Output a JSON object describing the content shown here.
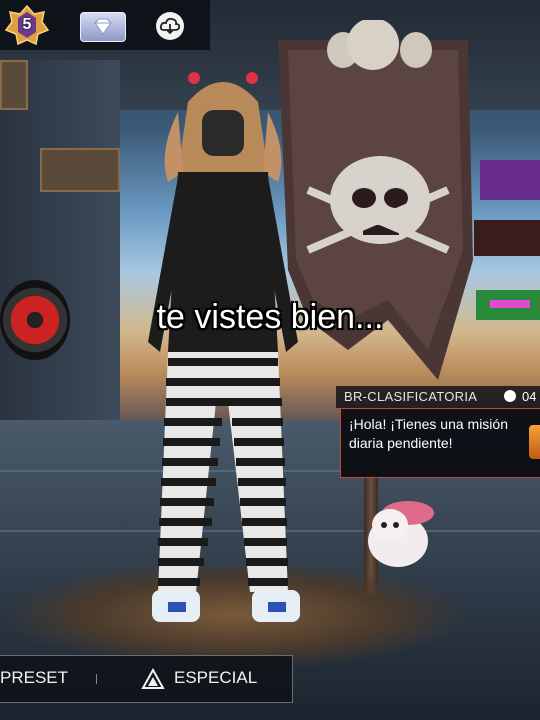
{
  "hud": {
    "rank_level": "5",
    "icons": [
      "rank-badge-icon",
      "diamond-icon",
      "cloud-download-icon"
    ]
  },
  "caption": "te vistes bien...",
  "mode": {
    "label": "BR-CLASIFICATORIA",
    "time": "04"
  },
  "mission": {
    "text": "¡Hola! ¡Tienes una misión diaria pendiente!"
  },
  "bottom": {
    "preset_label": "PRESET",
    "especial_label": "ESPECIAL"
  },
  "colors": {
    "accent_red": "#c6453a",
    "mission_orb": "#f7a23a"
  }
}
